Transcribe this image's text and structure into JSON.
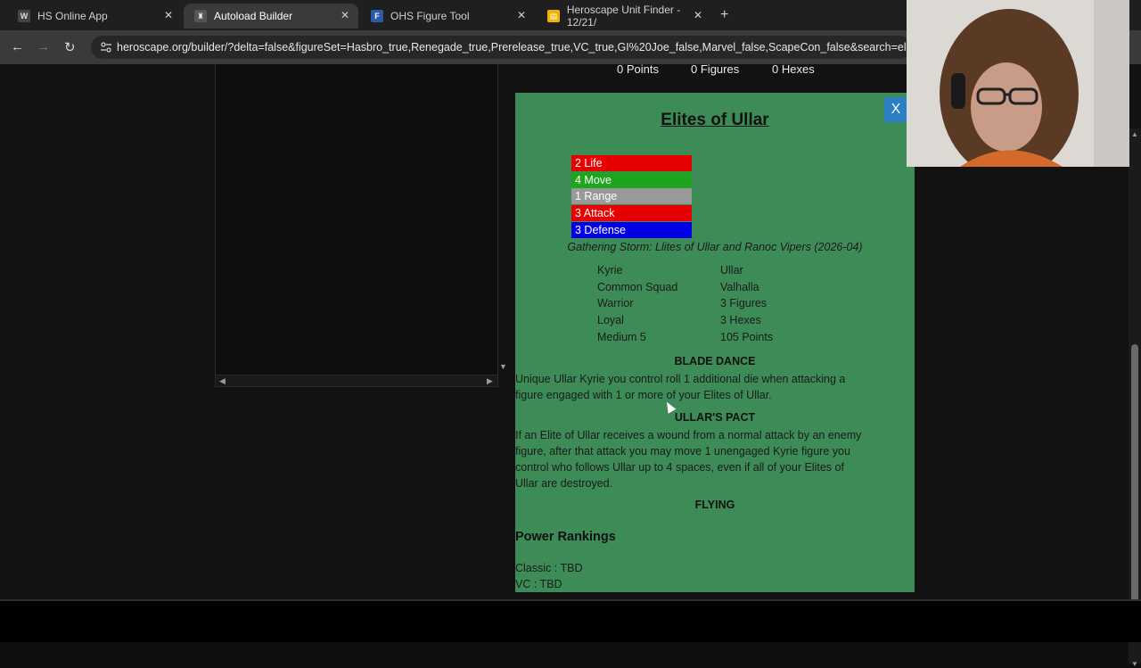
{
  "browser": {
    "tabs": [
      {
        "title": "HS Online App",
        "favicon": "hs-app-icon",
        "active": false
      },
      {
        "title": "Autoload Builder",
        "favicon": "heroscape-icon",
        "active": true
      },
      {
        "title": "OHS Figure Tool",
        "favicon": "ohs-tool-icon",
        "active": false
      },
      {
        "title": "Heroscape Unit Finder - 12/21/",
        "favicon": "sheets-icon",
        "active": false
      }
    ],
    "url": "heroscape.org/builder/?delta=false&figureSet=Hasbro_true,Renegade_true,Prerelease_true,VC_true,GI%20Joe_false,Marvel_false,ScapeCon_false&search=elit&sort1=points..."
  },
  "stats": {
    "points_value": "0",
    "points_label": "Points",
    "figures_value": "0",
    "figures_label": "Figures",
    "hexes_value": "0",
    "hexes_label": "Hexes"
  },
  "card": {
    "title": "Elites of Ullar",
    "close_label": "X",
    "stat_boxes": [
      {
        "label": "2 Life",
        "color": "#e60000"
      },
      {
        "label": "4 Move",
        "color": "#1ea51e"
      },
      {
        "label": "1 Range",
        "color": "#999999"
      },
      {
        "label": "3 Attack",
        "color": "#e60000"
      },
      {
        "label": "3 Defense",
        "color": "#0000e6"
      }
    ],
    "source": "Gathering Storm: Llites of Ullar and Ranoc Vipers (2026-04)",
    "info_left": [
      "Kyrie",
      "Common Squad",
      "Warrior",
      "Loyal",
      "Medium 5"
    ],
    "info_right": [
      "Ullar",
      "Valhalla",
      "3 Figures",
      "3 Hexes",
      "105 Points"
    ],
    "abilities": [
      {
        "name": "BLADE DANCE",
        "text_lines": [
          "Unique Ullar Kyrie you control roll 1 additional die when attacking a",
          "figure engaged with 1 or more of your Elites of Ullar."
        ]
      },
      {
        "name": "ULLAR'S PACT",
        "text_lines": [
          "If an Elite of Ullar receives a wound from a normal attack by an enemy",
          "figure, after that attack you may move 1 unengaged Kyrie figure you",
          "control who follows Ullar up to 4 spaces, even if all of your Elites of",
          "Ullar are destroyed."
        ]
      },
      {
        "name": "FLYING",
        "text_lines": []
      }
    ],
    "power_rankings_title": "Power Rankings",
    "rankings": [
      "Classic : TBD",
      "VC : TBD"
    ]
  }
}
